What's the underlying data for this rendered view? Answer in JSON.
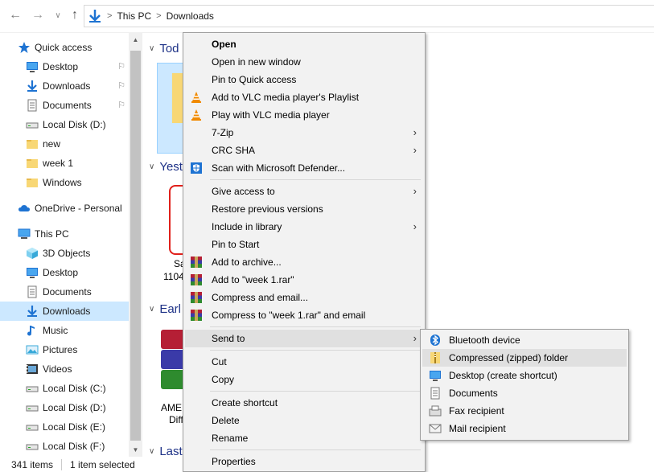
{
  "address": {
    "path": [
      "This PC",
      "Downloads"
    ],
    "sep_glyph": ">"
  },
  "nav": {
    "items": [
      {
        "label": "Quick access",
        "icon": "star-icon"
      },
      {
        "label": "Desktop",
        "icon": "desktop-icon",
        "pinned": true
      },
      {
        "label": "Downloads",
        "icon": "download-icon",
        "pinned": true
      },
      {
        "label": "Documents",
        "icon": "documents-icon",
        "pinned": true
      },
      {
        "label": "Local Disk (D:)",
        "icon": "drive-icon"
      },
      {
        "label": "new",
        "icon": "folder-icon"
      },
      {
        "label": "week 1",
        "icon": "folder-icon"
      },
      {
        "label": "Windows",
        "icon": "folder-icon"
      },
      {
        "label": "OneDrive - Personal",
        "icon": "cloud-icon"
      },
      {
        "label": "This PC",
        "icon": "computer-icon"
      },
      {
        "label": "3D Objects",
        "icon": "cube-icon"
      },
      {
        "label": "Desktop",
        "icon": "desktop-icon"
      },
      {
        "label": "Documents",
        "icon": "documents-icon"
      },
      {
        "label": "Downloads",
        "icon": "download-icon",
        "selected": true
      },
      {
        "label": "Music",
        "icon": "music-icon"
      },
      {
        "label": "Pictures",
        "icon": "pictures-icon"
      },
      {
        "label": "Videos",
        "icon": "videos-icon"
      },
      {
        "label": "Local Disk (C:)",
        "icon": "drive-icon"
      },
      {
        "label": "Local Disk (D:)",
        "icon": "drive-icon"
      },
      {
        "label": "Local Disk (E:)",
        "icon": "drive-icon"
      },
      {
        "label": "Local Disk (F:)",
        "icon": "drive-icon"
      }
    ]
  },
  "content": {
    "groups": [
      "Tod",
      "Yest",
      "Earl",
      "Last"
    ],
    "partial_labels": [
      "Sa",
      "1104",
      "AME",
      "Diffi"
    ]
  },
  "status": {
    "count": "341 items",
    "selected": "1 item selected"
  },
  "context_menu": {
    "items": [
      {
        "label": "Open",
        "bold": true
      },
      {
        "label": "Open in new window"
      },
      {
        "label": "Pin to Quick access"
      },
      {
        "label": "Add to VLC media player's Playlist",
        "icon": "vlc-icon"
      },
      {
        "label": "Play with VLC media player",
        "icon": "vlc-icon"
      },
      {
        "label": "7-Zip",
        "submenu": true
      },
      {
        "label": "CRC SHA",
        "submenu": true
      },
      {
        "label": "Scan with Microsoft Defender...",
        "icon": "defender-icon"
      },
      {
        "sep": true
      },
      {
        "label": "Give access to",
        "submenu": true
      },
      {
        "label": "Restore previous versions"
      },
      {
        "label": "Include in library",
        "submenu": true
      },
      {
        "label": "Pin to Start"
      },
      {
        "label": "Add to archive...",
        "icon": "winrar-icon"
      },
      {
        "label": "Add to \"week 1.rar\"",
        "icon": "winrar-icon"
      },
      {
        "label": "Compress and email...",
        "icon": "winrar-icon"
      },
      {
        "label": "Compress to \"week 1.rar\" and email",
        "icon": "winrar-icon"
      },
      {
        "sep": true
      },
      {
        "label": "Send to",
        "submenu": true,
        "hover": true
      },
      {
        "sep": true
      },
      {
        "label": "Cut"
      },
      {
        "label": "Copy"
      },
      {
        "sep": true
      },
      {
        "label": "Create shortcut"
      },
      {
        "label": "Delete"
      },
      {
        "label": "Rename"
      },
      {
        "sep": true
      },
      {
        "label": "Properties"
      }
    ]
  },
  "send_to": {
    "items": [
      {
        "label": "Bluetooth device",
        "icon": "bluetooth-icon"
      },
      {
        "label": "Compressed (zipped) folder",
        "icon": "zip-folder-icon",
        "hover": true
      },
      {
        "label": "Desktop (create shortcut)",
        "icon": "desktop-icon"
      },
      {
        "label": "Documents",
        "icon": "documents-icon"
      },
      {
        "label": "Fax recipient",
        "icon": "fax-icon"
      },
      {
        "label": "Mail recipient",
        "icon": "mail-icon"
      }
    ]
  },
  "colors": {
    "selection": "#cce8ff",
    "group_header": "#1e3287",
    "menu_bg": "#f2f2f2",
    "menu_hover": "#e0e0e0",
    "folder": "#f8d775",
    "accent_blue": "#1e73d2"
  }
}
